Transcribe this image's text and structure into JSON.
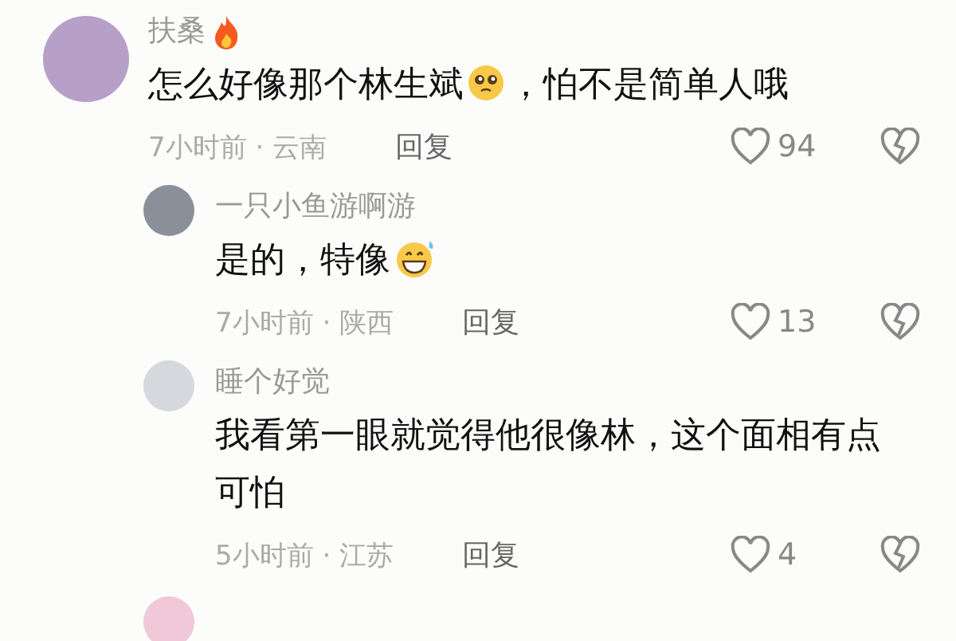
{
  "comments": [
    {
      "kind": "top",
      "author": "扶桑",
      "author_badge": {
        "kind": "fire"
      },
      "text": "怎么好像那个林生斌",
      "emoji": {
        "kind": "pleading"
      },
      "text_after": "，怕不是简单人哦",
      "time": "7小时前 · 云南",
      "reply": "回复",
      "likes": "94"
    },
    {
      "kind": "reply",
      "author": "一只小鱼游啊游",
      "text": "是的，特像",
      "emoji": {
        "kind": "grin-sweat"
      },
      "time": "7小时前 · 陕西",
      "reply": "回复",
      "likes": "13"
    },
    {
      "kind": "reply",
      "author": "睡个好觉",
      "text": "我看第一眼就觉得他很像林，这个面相有点可怕",
      "time": "5小时前 · 江苏",
      "reply": "回复",
      "likes": "4"
    },
    {
      "kind": "reply_partial"
    }
  ]
}
